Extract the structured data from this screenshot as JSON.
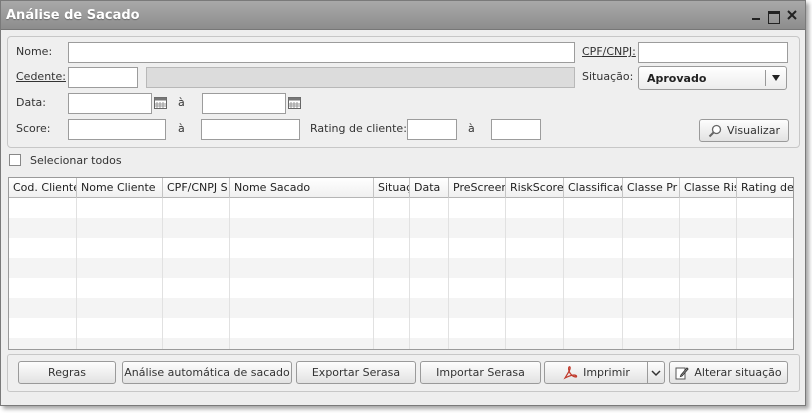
{
  "window": {
    "title": "Análise de Sacado"
  },
  "filters": {
    "nome_label": "Nome:",
    "nome_value": "",
    "cpf_label": "CPF/CNPJ:",
    "cpf_value": "",
    "cedente_label": "Cedente:",
    "cedente_value": "",
    "situacao_label": "Situação:",
    "situacao_value": "Aprovado",
    "data_label": "Data:",
    "data_from": "",
    "data_sep": "à",
    "data_to": "",
    "score_label": "Score:",
    "score_from": "",
    "score_sep": "à",
    "score_to": "",
    "rating_label": "Rating de cliente:",
    "rating_from": "",
    "rating_sep": "à",
    "rating_to": "",
    "visualizar_label": "Visualizar"
  },
  "select_all_label": "Selecionar todos",
  "grid": {
    "columns": [
      "Cod. Cliente",
      "Nome Cliente",
      "CPF/CNPJ S",
      "Nome Sacado",
      "Situação",
      "Data",
      "PreScreen",
      "RiskScore",
      "Classificação",
      "Classe Pr",
      "Classe Ris",
      "Rating de"
    ],
    "rows": []
  },
  "footer": {
    "regras": "Regras",
    "analise_auto": "Análise automática de sacado",
    "exportar": "Exportar Serasa",
    "importar": "Importar Serasa",
    "imprimir": "Imprimir",
    "alterar": "Alterar situação"
  },
  "colors": {
    "titlebar": "#9a9a9a",
    "panel": "#efefef",
    "accent_pdf": "#c0392b"
  }
}
